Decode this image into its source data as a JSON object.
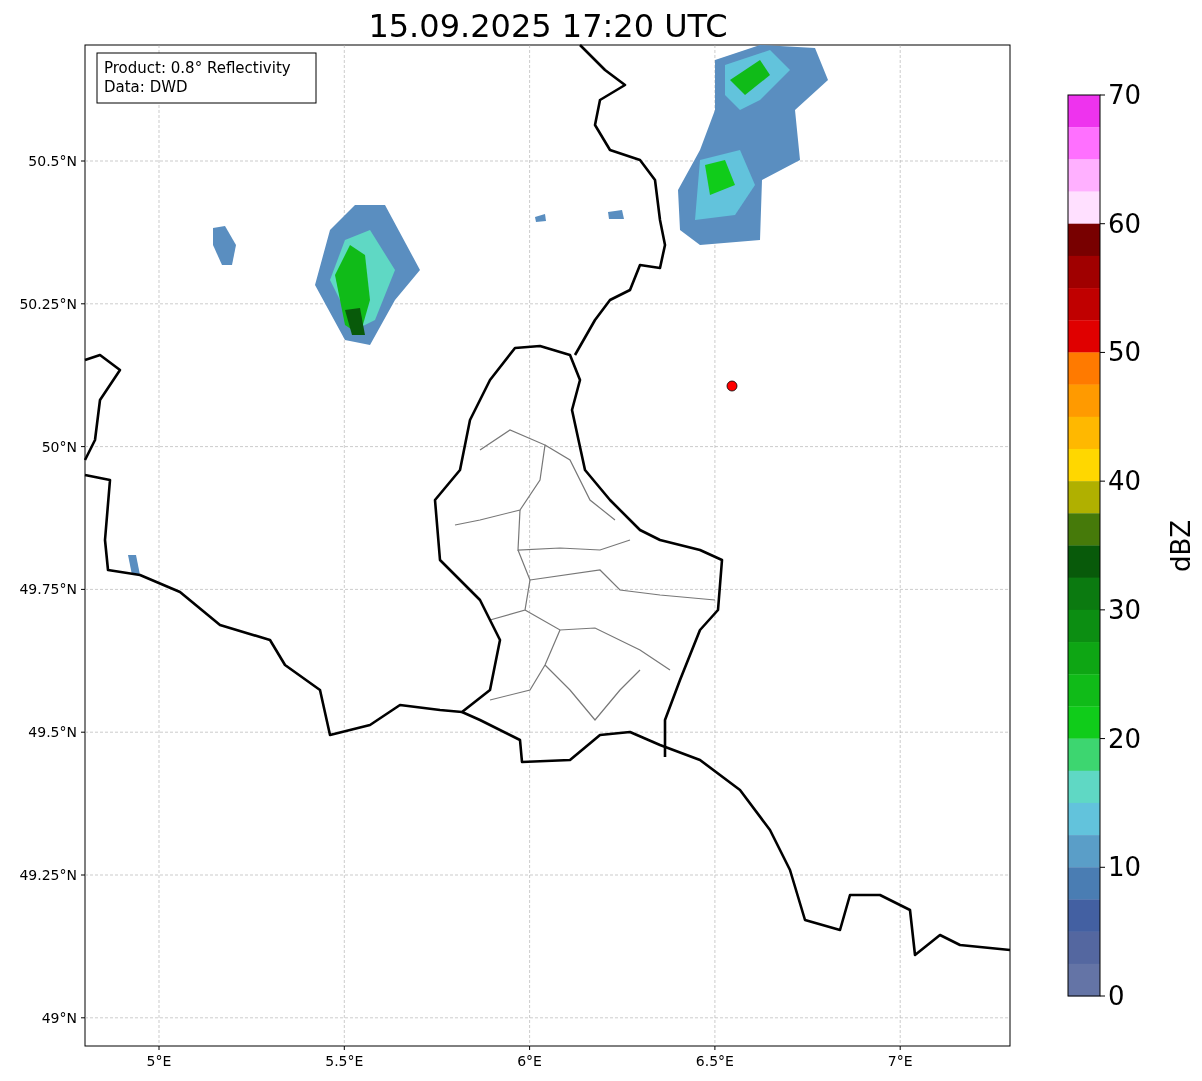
{
  "title": "15.09.2025 17:20 UTC",
  "info_box": [
    "Product: 0.8° Reflectivity",
    "Data: DWD"
  ],
  "map": {
    "lat_ticks": [
      "50.5°N",
      "50.25°N",
      "50°N",
      "49.75°N",
      "49.5°N",
      "49.25°N",
      "49°N"
    ],
    "lon_ticks": [
      "5°E",
      "5.5°E",
      "6°E",
      "6.5°E",
      "7°E"
    ]
  },
  "colorbar": {
    "label": "dBZ",
    "ticks": [
      "70",
      "60",
      "50",
      "40",
      "30",
      "20",
      "10",
      "0"
    ],
    "bins": [
      {
        "color": "#ee33ee"
      },
      {
        "color": "#ff70ff"
      },
      {
        "color": "#ffb0ff"
      },
      {
        "color": "#ffe0ff"
      },
      {
        "color": "#780000"
      },
      {
        "color": "#a00000"
      },
      {
        "color": "#c00000"
      },
      {
        "color": "#e00000"
      },
      {
        "color": "#ff7a00"
      },
      {
        "color": "#ff9a00"
      },
      {
        "color": "#ffb800"
      },
      {
        "color": "#ffd700"
      },
      {
        "color": "#b0b000"
      },
      {
        "color": "#467a0a"
      },
      {
        "color": "#085a0a"
      },
      {
        "color": "#0b7a10"
      },
      {
        "color": "#0c8e12"
      },
      {
        "color": "#0ea614"
      },
      {
        "color": "#10bb18"
      },
      {
        "color": "#10cc1a"
      },
      {
        "color": "#3dd670"
      },
      {
        "color": "#5fd8c4"
      },
      {
        "color": "#62c3dc"
      },
      {
        "color": "#5a9ec8"
      },
      {
        "color": "#4a7db3"
      },
      {
        "color": "#4360a2"
      },
      {
        "color": "#5467a0"
      },
      {
        "color": "#6474a6"
      }
    ]
  }
}
